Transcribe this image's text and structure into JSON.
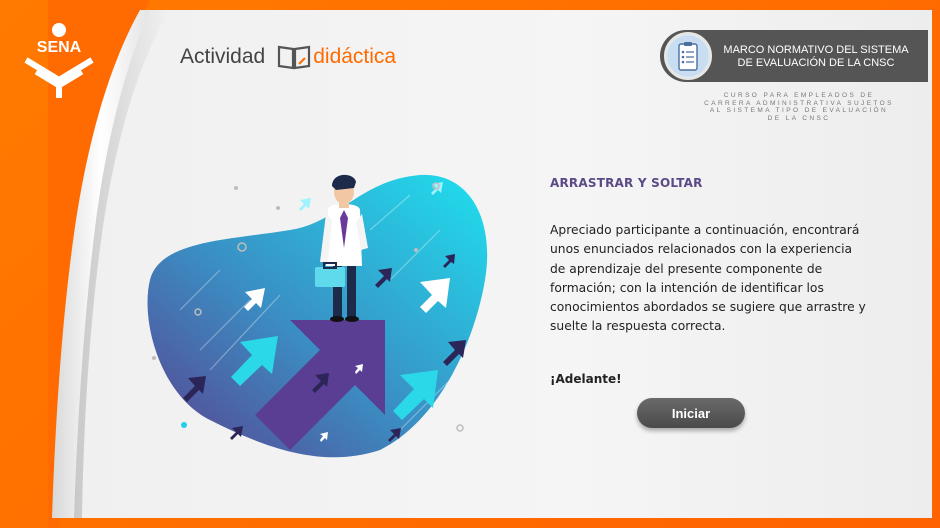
{
  "brand": {
    "logo_text": "SENA",
    "actividad": "Actividad",
    "didactica": "didáctica"
  },
  "course": {
    "title_line1": "MARCO NORMATIVO DEL SISTEMA",
    "title_line2": "DE EVALUACIÓN DE LA CNSC",
    "subtitle_line1": "CURSO PARA EMPLEADOS DE",
    "subtitle_line2": "CARRERA ADMINISTRATIVA SUJETOS",
    "subtitle_line3": "AL SISTEMA TIPO DE EVALUACIÓN",
    "subtitle_line4": "DE LA CNSC"
  },
  "activity": {
    "heading": "ARRASTRAR Y SOLTAR",
    "description": "Apreciado participante a continuación, encontrará unos enunciados relacionados con la experiencia de aprendizaje del presente componente de formación; con la intención de identificar los conocimientos abordados se sugiere que arrastre y suelte la respuesta correcta.",
    "cta_text": "¡Adelante!",
    "start_label": "Iniciar"
  },
  "colors": {
    "orange": "#ff6b00",
    "purple": "#5b4a86",
    "cyan": "#1fd1e8",
    "dark_gray": "#555555"
  },
  "icons": [
    "sena-logo-icon",
    "book-icon",
    "clipboard-icon"
  ]
}
